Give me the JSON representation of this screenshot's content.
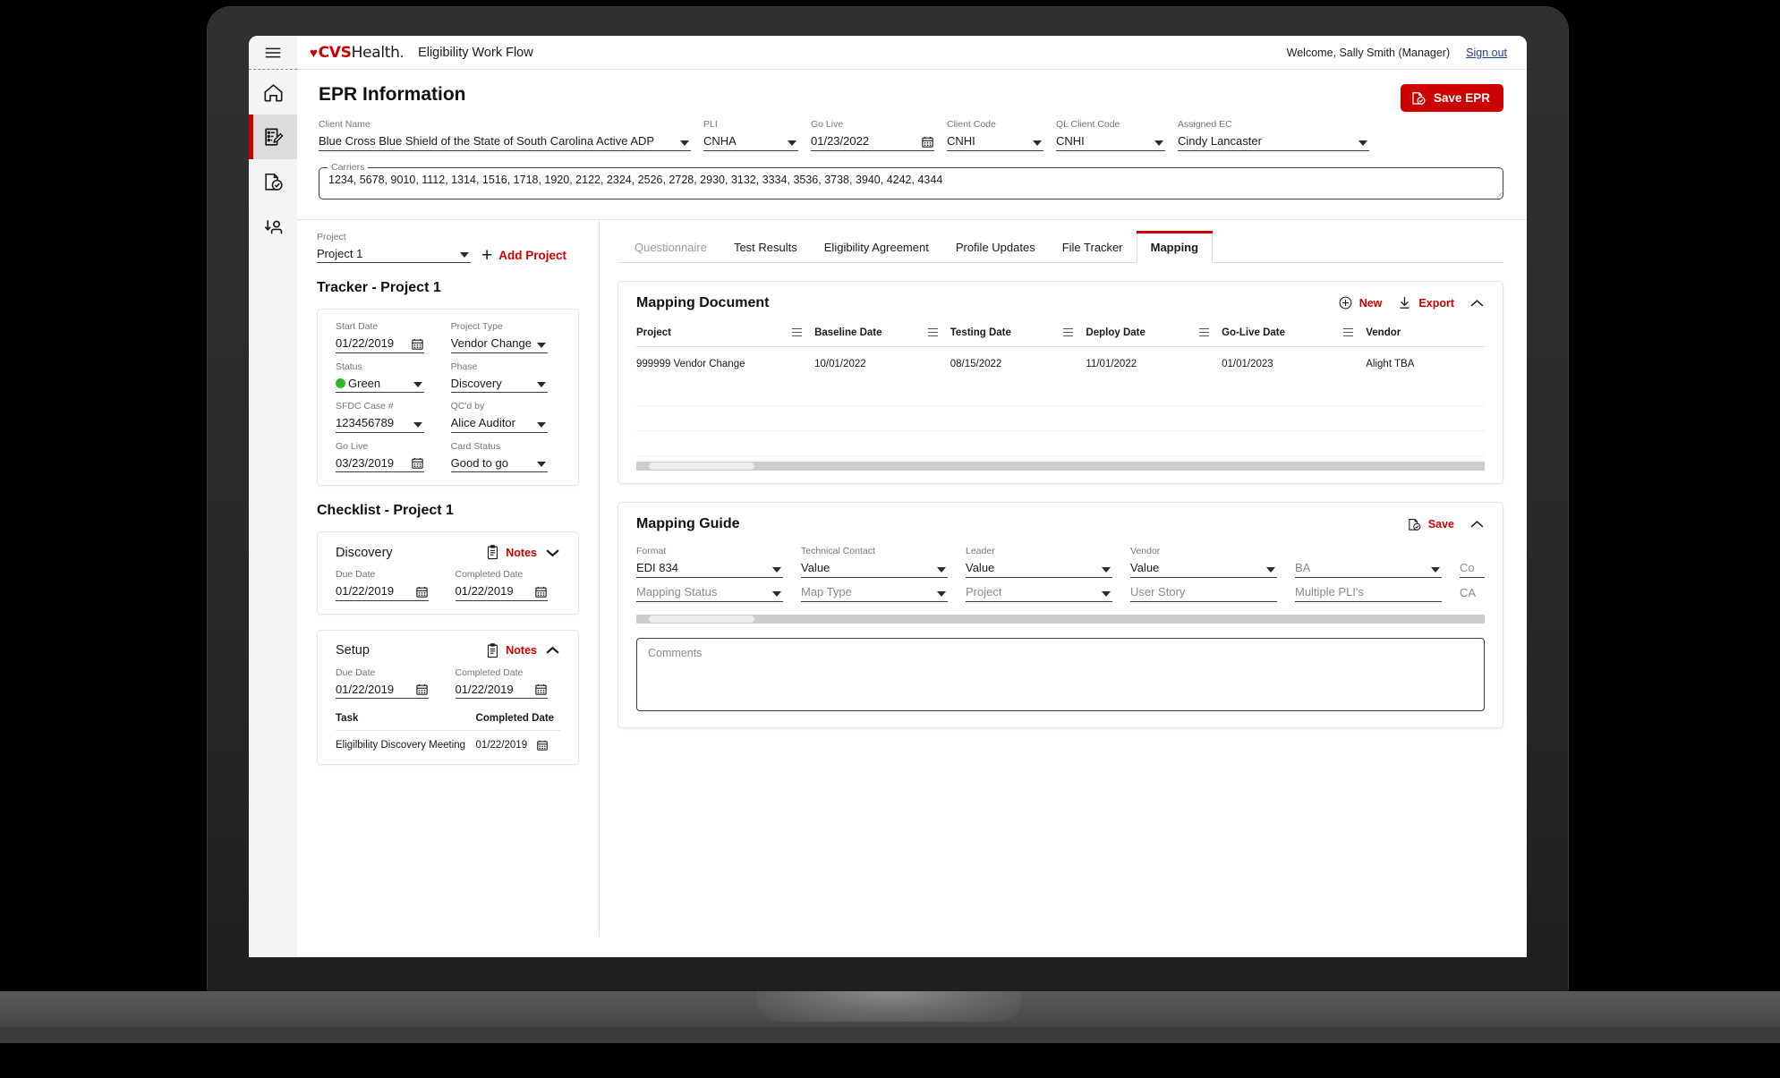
{
  "topbar": {
    "brand_heart": "♥",
    "brand_cvs": "CVS",
    "brand_health": "Health",
    "brand_dot": ".",
    "app_title": "Eligibility Work Flow",
    "welcome": "Welcome, Sally Smith (Manager)",
    "signout": "Sign out"
  },
  "rail": {
    "items": [
      {
        "name": "home",
        "label": "Home"
      },
      {
        "name": "epr-form",
        "label": "EPR Form"
      },
      {
        "name": "document-check",
        "label": "Approvals"
      },
      {
        "name": "person-import",
        "label": "Member Import"
      }
    ]
  },
  "epr": {
    "title": "EPR Information",
    "save_label": "Save EPR",
    "fields": [
      {
        "label": "Client Name",
        "value": "Blue Cross Blue Shield of the State of South Carolina Active ADP",
        "control": "select"
      },
      {
        "label": "PLI",
        "value": "CNHA",
        "control": "select"
      },
      {
        "label": "Go Live",
        "value": "01/23/2022",
        "control": "date"
      },
      {
        "label": "Client Code",
        "value": "CNHI",
        "control": "select"
      },
      {
        "label": "QL Client Code",
        "value": "CNHI",
        "control": "select"
      },
      {
        "label": "Assigned EC",
        "value": "Cindy Lancaster",
        "control": "select"
      }
    ],
    "carriers_label": "Carriers",
    "carriers_value": "1234, 5678, 9010, 1112, 1314, 1516, 1718, 1920, 2122, 2324, 2526, 2728, 2930, 3132, 3334, 3536, 3738, 3940, 4242, 4344"
  },
  "left_pane": {
    "project_label": "Project",
    "project_value": "Project 1",
    "add_project_label": "Add Project",
    "tracker_heading": "Tracker - Project 1",
    "tracker_fields": [
      {
        "label": "Start Date",
        "value": "01/22/2019",
        "control": "date"
      },
      {
        "label": "Project Type",
        "value": "Vendor Change",
        "control": "select"
      },
      {
        "label": "Status",
        "value": "Green",
        "control": "select",
        "dot": "#2eb82e"
      },
      {
        "label": "Phase",
        "value": "Discovery",
        "control": "select"
      },
      {
        "label": "SFDC Case #",
        "value": "123456789",
        "control": "select"
      },
      {
        "label": "QC'd by",
        "value": "Alice Auditor",
        "control": "select"
      },
      {
        "label": "Go Live",
        "value": "03/23/2019",
        "control": "date"
      },
      {
        "label": "Card Status",
        "value": "Good to go",
        "control": "select"
      }
    ],
    "checklist_heading": "Checklist - Project 1",
    "notes_label": "Notes",
    "checklist": [
      {
        "title": "Discovery",
        "expanded": false,
        "due_label": "Due Date",
        "due_value": "01/22/2019",
        "completed_label": "Completed Date",
        "completed_value": "01/22/2019"
      },
      {
        "title": "Setup",
        "expanded": true,
        "due_label": "Due Date",
        "due_value": "01/22/2019",
        "completed_label": "Completed Date",
        "completed_value": "01/22/2019",
        "task_headers": [
          "Task",
          "Completed Date"
        ],
        "tasks": [
          {
            "task": "Eligilbility Discovery Meeting",
            "completed": "01/22/2019"
          }
        ]
      }
    ]
  },
  "tabs": [
    {
      "label": "Questionnaire",
      "state": "disabled"
    },
    {
      "label": "Test Results",
      "state": "normal"
    },
    {
      "label": "Eligibility Agreement",
      "state": "normal"
    },
    {
      "label": "Profile Updates",
      "state": "normal"
    },
    {
      "label": "File Tracker",
      "state": "normal"
    },
    {
      "label": "Mapping",
      "state": "active"
    }
  ],
  "mapping_document": {
    "title": "Mapping Document",
    "new_label": "New",
    "export_label": "Export",
    "columns": [
      "Project",
      "Baseline Date",
      "Testing Date",
      "Deploy Date",
      "Go-Live Date",
      "Vendor"
    ],
    "rows": [
      [
        "999999 Vendor Change",
        "10/01/2022",
        "08/15/2022",
        "11/01/2022",
        "01/01/2023",
        "Alight TBA"
      ]
    ]
  },
  "mapping_guide": {
    "title": "Mapping Guide",
    "save_label": "Save",
    "row1": [
      {
        "label": "Format",
        "value": "EDI 834",
        "control": "select"
      },
      {
        "label": "Technical Contact",
        "value": "Value",
        "control": "select"
      },
      {
        "label": "Leader",
        "value": "Value",
        "control": "select"
      },
      {
        "label": "Vendor",
        "value": "Value",
        "control": "select"
      },
      {
        "label": "",
        "value": "BA",
        "control": "select",
        "placeholder": true
      },
      {
        "label": "",
        "value": "Co",
        "control": "text",
        "placeholder": true
      }
    ],
    "row2": [
      {
        "label": "",
        "value": "Mapping Status",
        "control": "select",
        "placeholder": true
      },
      {
        "label": "",
        "value": "Map Type",
        "control": "select",
        "placeholder": true
      },
      {
        "label": "",
        "value": "Project",
        "control": "select",
        "placeholder": true
      },
      {
        "label": "",
        "value": "User Story",
        "control": "text",
        "placeholder": true
      },
      {
        "label": "",
        "value": "Multiple PLI's",
        "control": "text",
        "placeholder": true
      },
      {
        "label": "",
        "value": "CA",
        "control": "text",
        "placeholder": true
      }
    ],
    "comments_placeholder": "Comments"
  },
  "colors": {
    "brand_red": "#cc0000",
    "status_green": "#2eb82e",
    "link_blue": "#1b3f94"
  }
}
